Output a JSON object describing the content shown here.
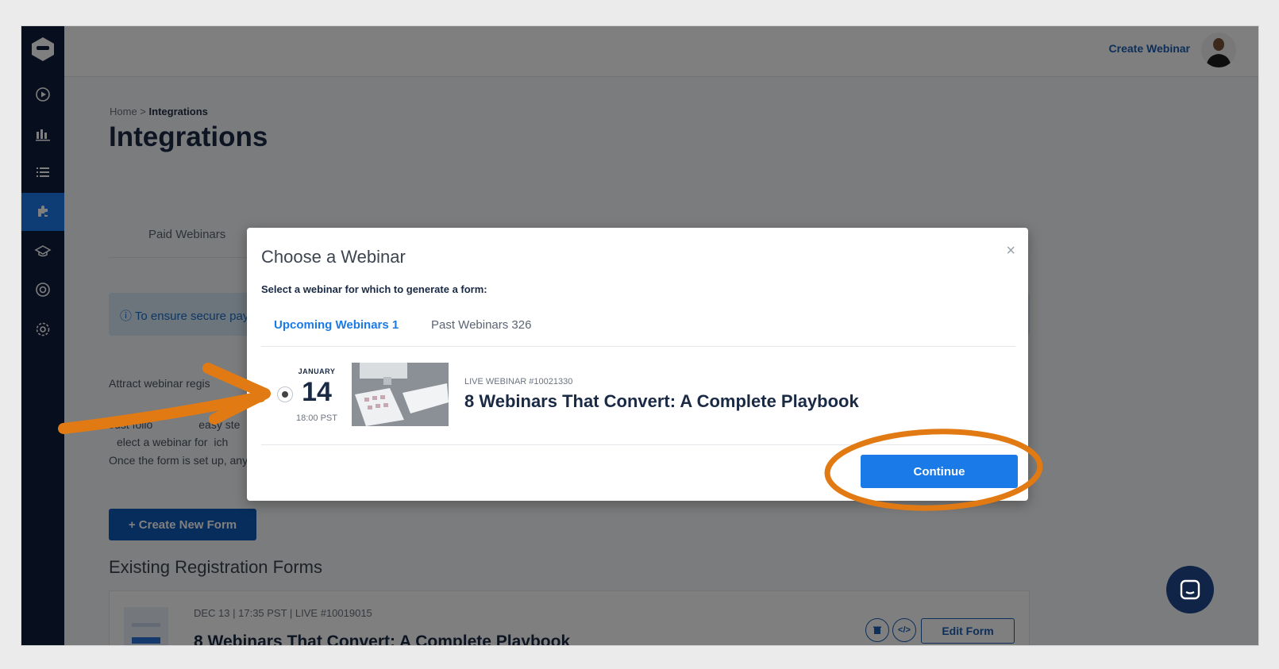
{
  "topbar": {
    "create_webinar": "Create Webinar"
  },
  "breadcrumb": {
    "home": "Home",
    "separator": " > ",
    "current": "Integrations"
  },
  "page": {
    "title": "Integrations",
    "tab_paid": "Paid Webinars",
    "info_text": "To ensure secure paym",
    "para1": "Attract webinar regis",
    "para2": "Just follo",
    "para2b": "easy ste",
    "para3": "elect a webinar for",
    "para3b": "ich",
    "para4": "Once the form is set up, any",
    "create_form_button": "+ Create New Form",
    "existing_title": "Existing Registration Forms"
  },
  "form_card": {
    "meta": "DEC 13  |  17:35 PST  |  LIVE #10019015",
    "title": "8 Webinars That Convert: A Complete Playbook",
    "delete_icon": "trash-icon",
    "embed_icon": "code-icon",
    "edit_button": "Edit Form"
  },
  "modal": {
    "title": "Choose a Webinar",
    "close": "×",
    "subtitle": "Select a webinar for which to generate a form:",
    "tab_upcoming": "Upcoming Webinars 1",
    "tab_past": "Past Webinars 326",
    "webinar": {
      "month": "JANUARY",
      "day": "14",
      "time": "18:00 PST",
      "id_label": "LIVE WEBINAR #10021330",
      "title": "8 Webinars That Convert: A Complete Playbook"
    },
    "continue_button": "Continue"
  },
  "colors": {
    "accent": "#1a7ae8",
    "sidebar": "#0f1d3d",
    "annotation": "#e27a14"
  }
}
